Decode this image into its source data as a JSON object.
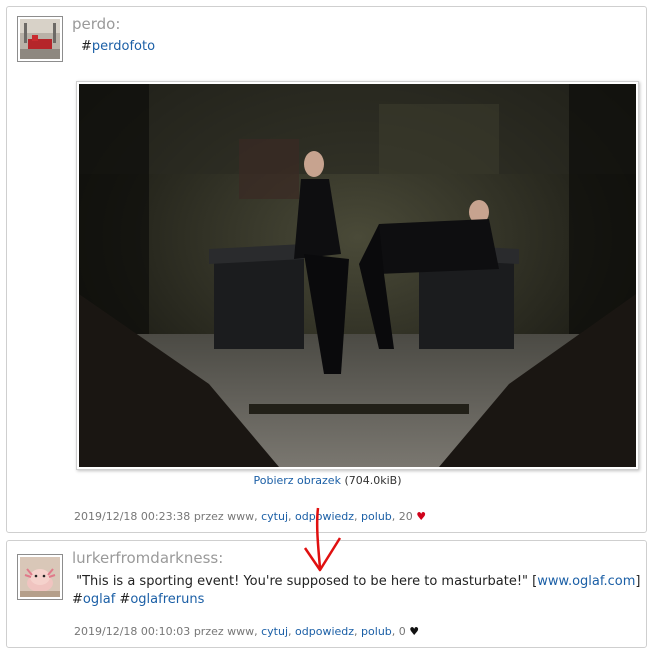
{
  "posts": [
    {
      "author": "perdo:",
      "hashtag_prefix": "#",
      "hashtag": "perdofoto",
      "download_link": "Pobierz obrazek",
      "download_size": "(704.0kiB)",
      "meta": {
        "timestamp": "2019/12/18 00:23:38",
        "by": "przez www,",
        "quote": "cytuj",
        "reply": "odpowiedz",
        "like": "polub",
        "likes": "20",
        "heart": "♥"
      }
    },
    {
      "author": "lurkerfromdarkness:",
      "quote_text": "\"This is a sporting event! You're supposed to be here to masturbate!\"",
      "link_open": "[",
      "link_text": "www.oglaf.com",
      "link_close": "]",
      "tag1_prefix": "#",
      "tag1": "oglaf",
      "tag2_prefix": "#",
      "tag2": "oglafreruns",
      "meta": {
        "timestamp": "2019/12/18 00:10:03",
        "by": "przez www,",
        "quote": "cytuj",
        "reply": "odpowiedz",
        "like": "polub",
        "likes": "0",
        "heart": "♥"
      }
    }
  ],
  "colors": {
    "link": "#1b5fa6",
    "annotation_arrow": "#e01010",
    "heart_liked": "#d0021b"
  }
}
